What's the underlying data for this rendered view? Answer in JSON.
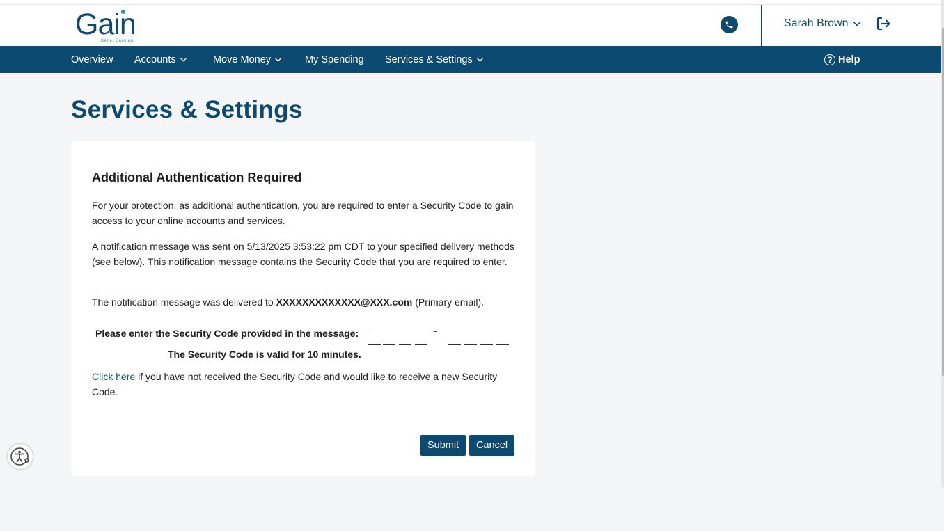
{
  "brand": {
    "name": "Gain",
    "tagline": "Better Banking"
  },
  "header": {
    "user_name": "Sarah Brown",
    "phone_icon": "phone-icon",
    "logout_icon": "logout-icon"
  },
  "nav": {
    "items": [
      {
        "label": "Overview",
        "has_dropdown": false
      },
      {
        "label": "Accounts",
        "has_dropdown": true
      },
      {
        "label": "Move Money",
        "has_dropdown": true
      },
      {
        "label": "My Spending",
        "has_dropdown": false
      },
      {
        "label": "Services & Settings",
        "has_dropdown": true
      }
    ],
    "help_label": "Help"
  },
  "main": {
    "page_title": "Services & Settings",
    "card": {
      "title": "Additional Authentication Required",
      "para1": "For your protection, as additional authentication, you are required to enter a Security Code to gain access to your online accounts and services.",
      "para2": "A notification message was sent on 5/13/2025 3:53:22 pm CDT to your specified delivery methods (see below). This notification message contains the Security Code that you are required to enter.",
      "para3_prefix": "The notification message was delivered to ",
      "para3_email": "XXXXXXXXXXXXX@XXX.com",
      "para3_suffix": " (Primary email).",
      "code_label": "Please enter the Security Code provided in the message:",
      "code_separator": "-",
      "code_valid": "The Security Code is valid for 10 minutes.",
      "resend_link": "Click here",
      "resend_text": " if you have not received the Security Code and would like to receive a new Security Code.",
      "submit_label": "Submit",
      "cancel_label": "Cancel"
    }
  },
  "colors": {
    "brand_navy": "#0d4a72",
    "brand_green": "#2f9e6a",
    "content_bg": "#f3f5f7"
  }
}
